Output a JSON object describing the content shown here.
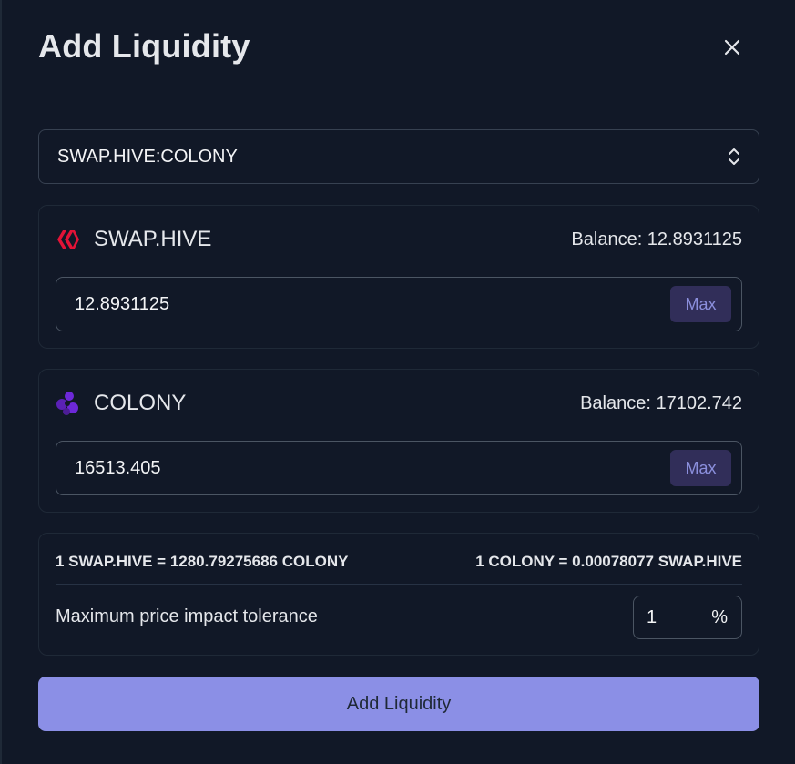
{
  "modal": {
    "title": "Add Liquidity",
    "close_icon": "close-icon"
  },
  "pair_select": {
    "value": "SWAP.HIVE:COLONY",
    "icon": "chevron-up-down-icon"
  },
  "token_a": {
    "name": "SWAP.HIVE",
    "icon": "hive-logo-icon",
    "icon_color": "#e31337",
    "balance_text": "Balance: 12.8931125",
    "amount": "12.8931125",
    "max_label": "Max"
  },
  "token_b": {
    "name": "COLONY",
    "icon": "colony-logo-icon",
    "icon_color": "#6d28d9",
    "balance_text": "Balance: 17102.742",
    "amount": "16513.405",
    "max_label": "Max"
  },
  "info": {
    "rate_a": "1 SWAP.HIVE = 1280.79275686 COLONY",
    "rate_b": "1 COLONY = 0.00078077 SWAP.HIVE",
    "tolerance_label": "Maximum price impact tolerance",
    "tolerance_value": "1",
    "tolerance_unit": "%"
  },
  "submit": {
    "label": "Add Liquidity",
    "color": "#8b8fe6"
  }
}
